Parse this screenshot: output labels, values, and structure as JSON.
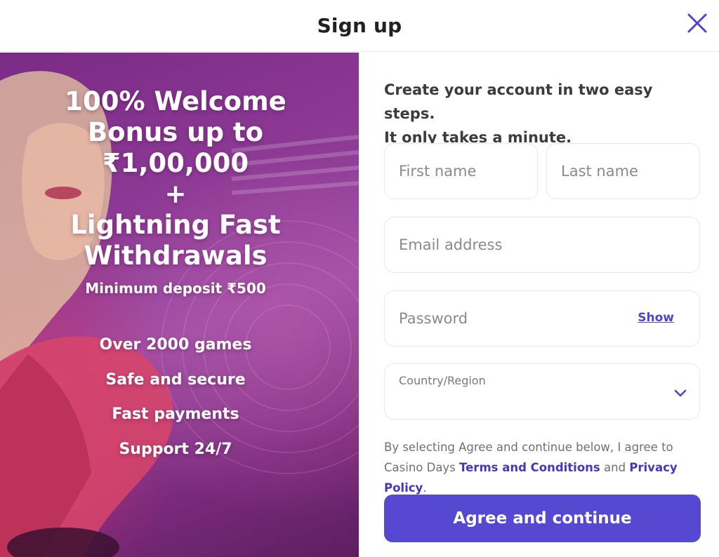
{
  "header": {
    "title": "Sign up",
    "close_icon": "close-icon"
  },
  "promo": {
    "headline_lines": [
      "100% Welcome",
      "Bonus up to",
      "₹1,00,000",
      "+",
      "Lightning Fast",
      "Withdrawals"
    ],
    "min_deposit": "Minimum deposit ₹500",
    "features": [
      "Over 2000 games",
      "Safe and secure",
      "Fast payments",
      "Support 24/7"
    ]
  },
  "form": {
    "intro_line1": "Create your account in two easy steps.",
    "intro_line2": "It only takes a minute.",
    "first_name_placeholder": "First name",
    "last_name_placeholder": "Last name",
    "email_placeholder": "Email address",
    "password_placeholder": "Password",
    "show_label": "Show",
    "country_label": "Country/Region",
    "country_value": "",
    "legal": {
      "prefix": "By selecting Agree and continue below, I agree to Casino Days ",
      "terms_link": "Terms and Conditions",
      "middle": " and ",
      "privacy_link": "Privacy Policy",
      "suffix": "."
    },
    "submit_label": "Agree and continue"
  },
  "colors": {
    "accent": "#5548d1",
    "link": "#4437b8",
    "promo_bg": "#8e3b96"
  }
}
